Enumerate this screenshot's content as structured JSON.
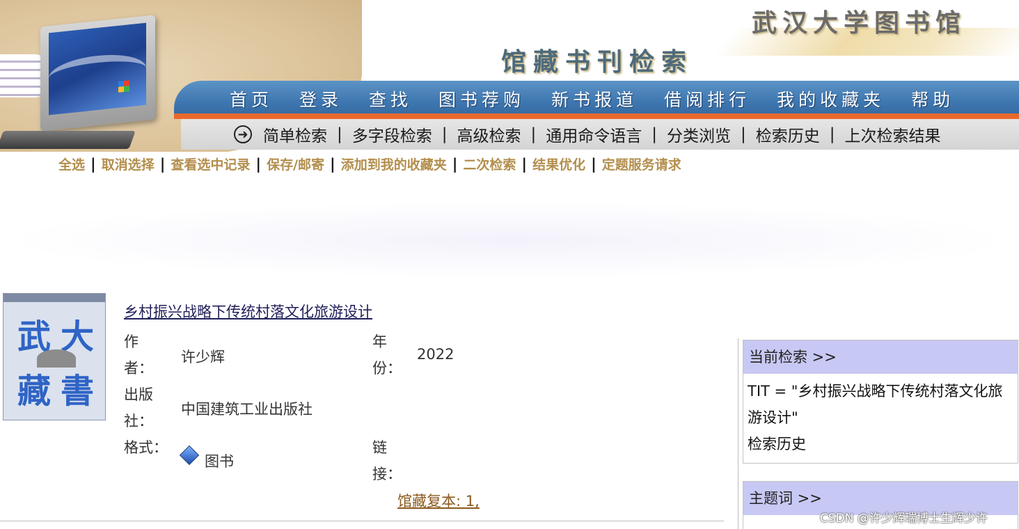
{
  "header": {
    "site_title": "武汉大学图书馆",
    "section_title": "馆藏书刊检索",
    "nav": [
      "首页",
      "登录",
      "查找",
      "图书荐购",
      "新书报道",
      "借阅排行",
      "我的收藏夹",
      "帮助"
    ],
    "sub_nav": [
      "简单检索",
      "多字段检索",
      "高级检索",
      "通用命令语言",
      "分类浏览",
      "检索历史",
      "上次检索结果"
    ]
  },
  "actions": [
    "全选",
    "取消选择",
    "查看选中记录",
    "保存/邮寄",
    "添加到我的收藏夹",
    "二次检索",
    "结果优化",
    "定题服务请求"
  ],
  "record": {
    "cover": {
      "c1": "武",
      "c2": "大",
      "c3": "藏",
      "c4": "書"
    },
    "title": "乡村振兴战略下传统村落文化旅游设计",
    "author_label": "作者：",
    "author": "许少辉",
    "year_label": "年份：",
    "year": "2022",
    "publisher_label": "出版社：",
    "publisher": "中国建筑工业出版社",
    "format_label": "格式：",
    "format": "图书",
    "format_icon": "book-icon",
    "link_label": "链接：",
    "holdings": "馆藏复本: 1,"
  },
  "sidebar": {
    "current_search_header": "当前检索 >>",
    "current_search_query": "TIT = \"乡村振兴战略下传统村落文化旅游设计\"",
    "search_history_link": "检索历史",
    "subject_header": "主题词 >>"
  },
  "watermark": "CSDN @许少辉瑞博士生辉少许",
  "colors": {
    "nav_blue": "#3f77b0",
    "nav_orange": "#e9692c",
    "action_gold": "#b38e4c",
    "panel_header": "#c8c8f4"
  }
}
